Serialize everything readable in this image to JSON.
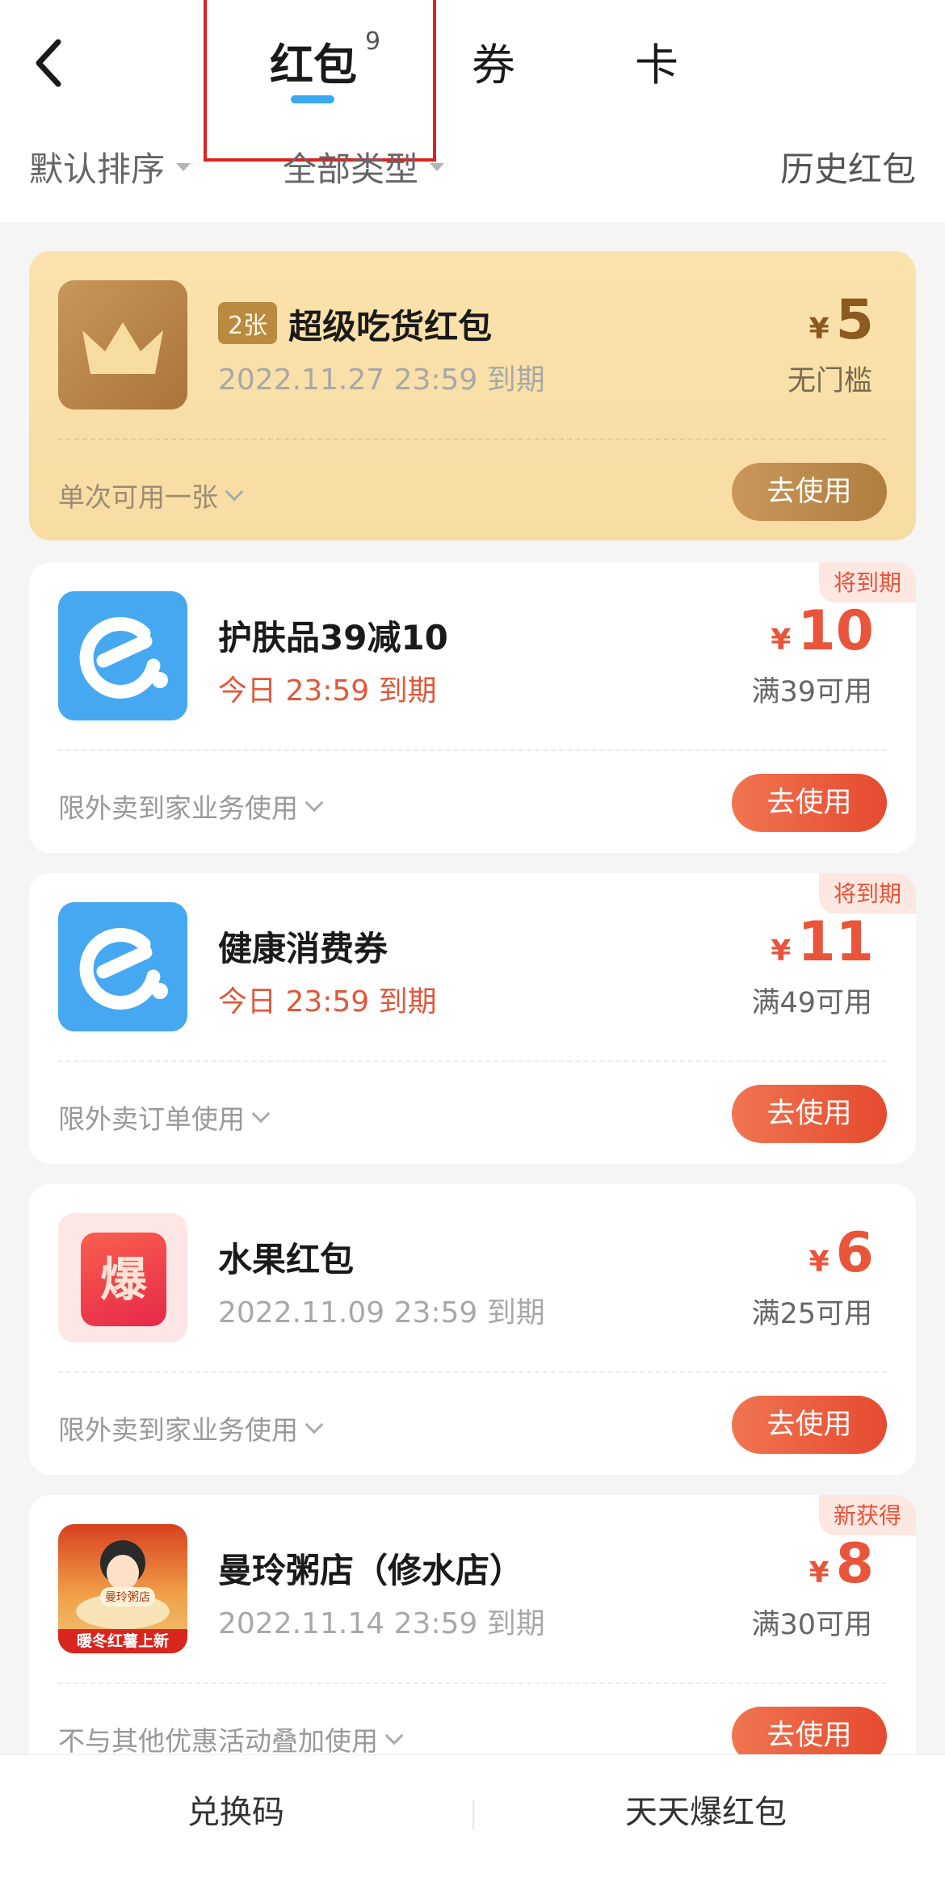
{
  "header": {
    "tabs": [
      {
        "label": "红包",
        "count": "9"
      },
      {
        "label": "券"
      },
      {
        "label": "卡"
      }
    ],
    "filters": {
      "sort": "默认排序",
      "type": "全部类型",
      "history": "历史红包"
    }
  },
  "cards": [
    {
      "badge": "2张",
      "title": "超级吃货红包",
      "expiry": "2022.11.27 23:59 到期",
      "currency": "¥",
      "amount": "5",
      "condition": "无门槛",
      "note": "单次可用一张",
      "button": "去使用",
      "icon": "crown-icon"
    },
    {
      "tag": "将到期",
      "title": "护肤品39减10",
      "expiry": "今日 23:59 到期",
      "currency": "¥",
      "amount": "10",
      "condition": "满39可用",
      "note": "限外卖到家业务使用",
      "button": "去使用",
      "icon": "eleme-logo-icon"
    },
    {
      "tag": "将到期",
      "title": "健康消费券",
      "expiry": "今日 23:59 到期",
      "currency": "¥",
      "amount": "11",
      "condition": "满49可用",
      "note": "限外卖订单使用",
      "button": "去使用",
      "icon": "eleme-logo-icon"
    },
    {
      "title": "水果红包",
      "expiry": "2022.11.09 23:59 到期",
      "currency": "¥",
      "amount": "6",
      "condition": "满25可用",
      "note": "限外卖到家业务使用",
      "button": "去使用",
      "icon": "bao-icon",
      "icon_text": "爆"
    },
    {
      "tag": "新获得",
      "title": "曼玲粥店（修水店）",
      "expiry": "2022.11.14 23:59 到期",
      "currency": "¥",
      "amount": "8",
      "condition": "满30可用",
      "note": "不与其他优惠活动叠加使用",
      "button": "去使用",
      "icon": "store-logo-icon",
      "icon_text": "暖冬红薯上新",
      "icon_sign": "曼玲粥店"
    }
  ],
  "footer": {
    "left": "兑换码",
    "right": "天天爆红包"
  },
  "colors": {
    "accent_blue": "#3aa8f0",
    "red": "#e8553a",
    "gold": "#f7dca3",
    "highlight_box": "#e02020"
  }
}
